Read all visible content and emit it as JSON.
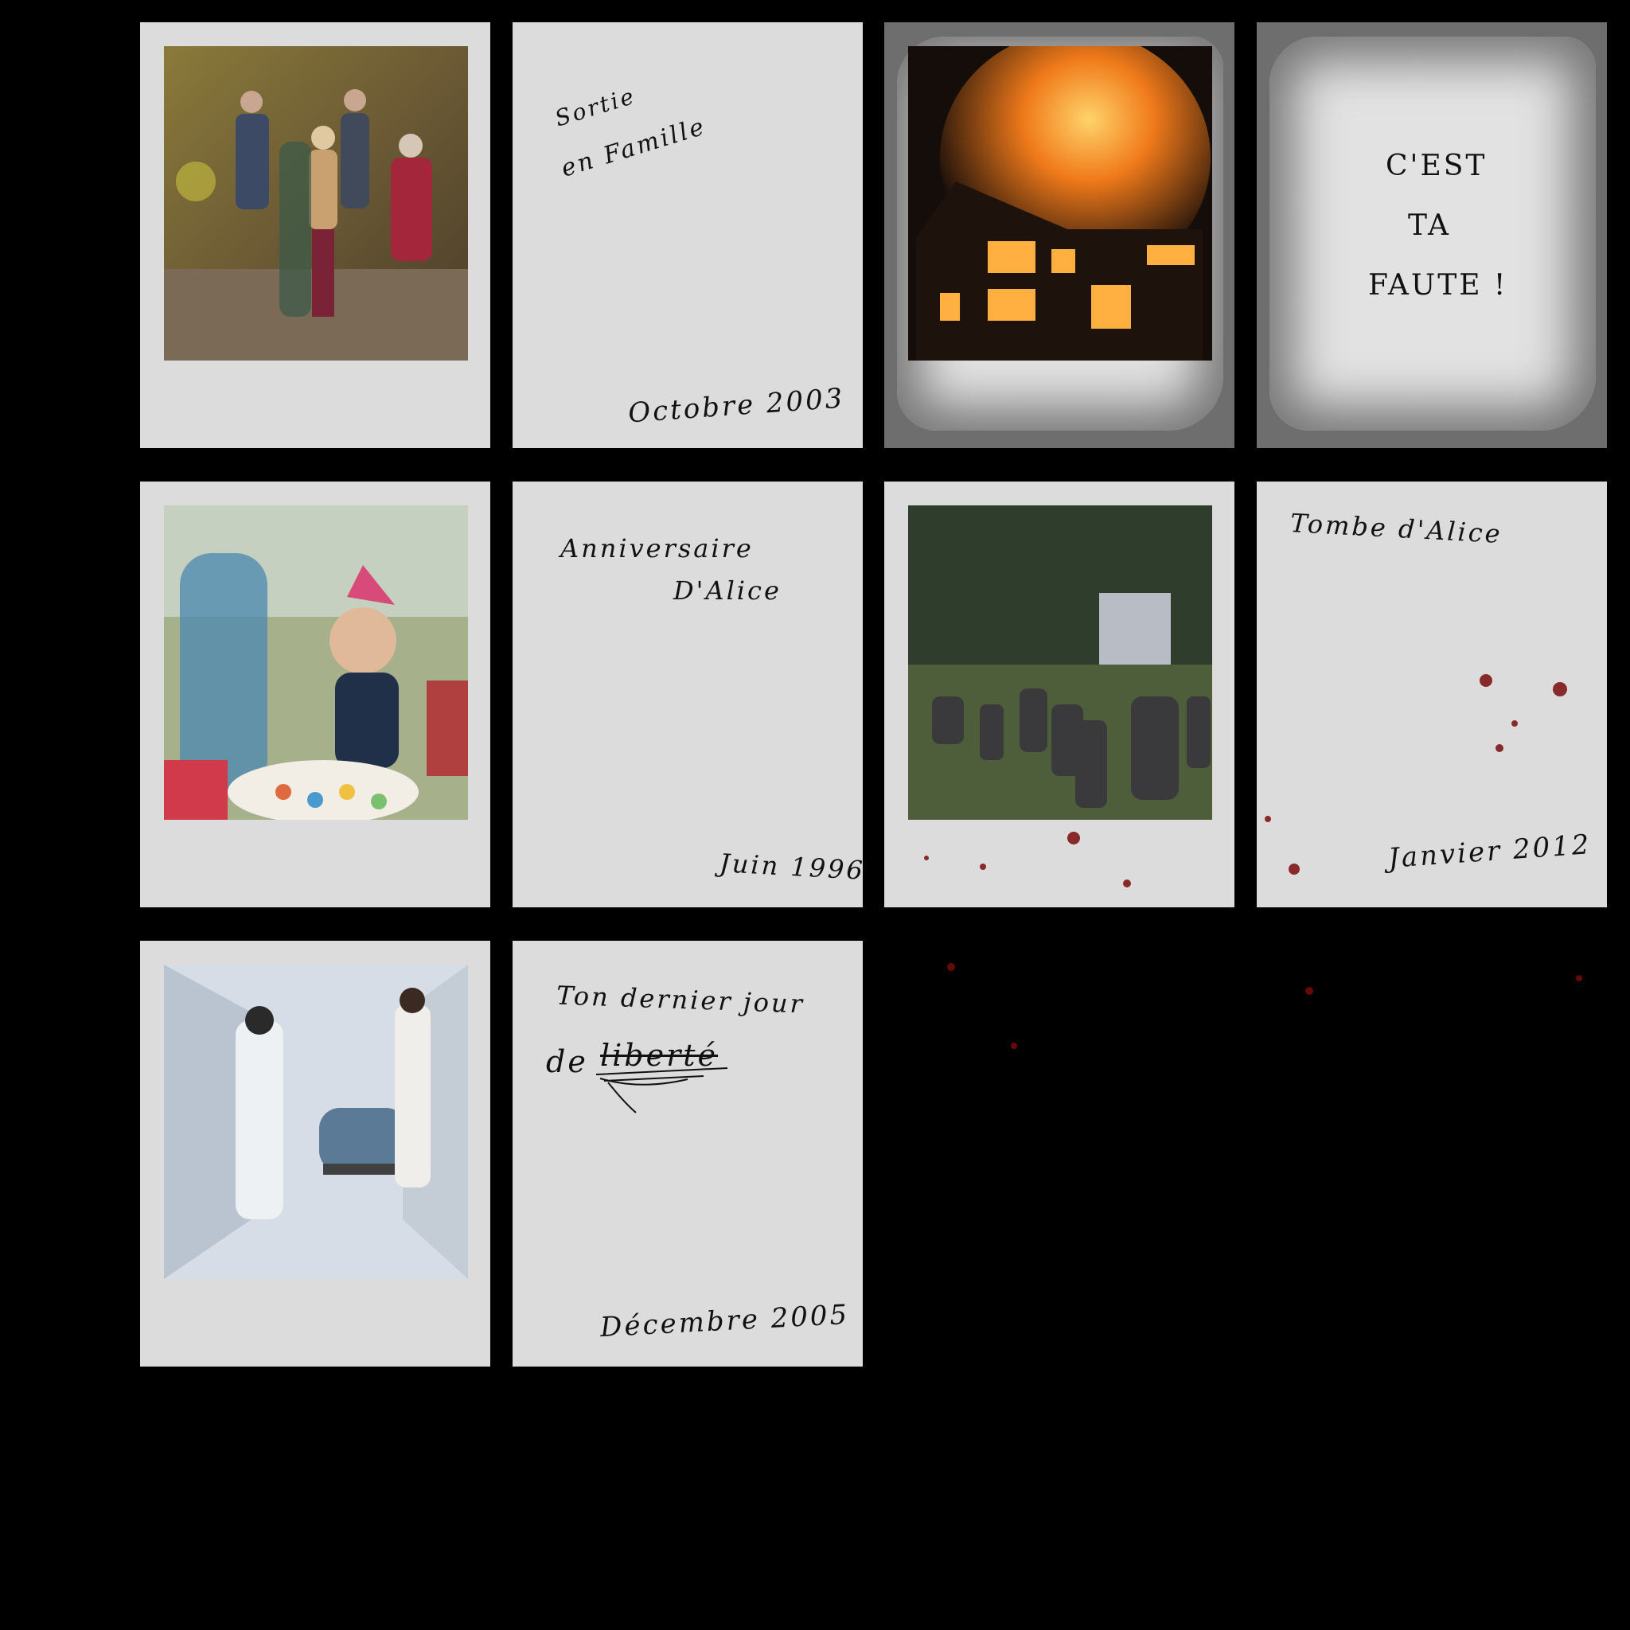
{
  "cards": {
    "family": {
      "caption_line1": "Sortie",
      "caption_line2": "en Famille",
      "date": "Octobre 2003"
    },
    "fire": {
      "message_line1": "C'EST",
      "message_line2": "TA",
      "message_line3": "FAUTE !"
    },
    "birthday": {
      "caption_line1": "Anniversaire",
      "caption_line2": "D'Alice",
      "date": "Juin 1996"
    },
    "grave": {
      "caption": "Tombe d'Alice",
      "date": "Janvier 2012"
    },
    "hospital": {
      "caption_line1": "Ton dernier jour",
      "caption_prefix": "de",
      "caption_struck": "liberté",
      "date": "Décembre 2005"
    }
  },
  "colors": {
    "background": "#000000",
    "card": "#dcdcdc",
    "blood": "#7a0a0a"
  }
}
